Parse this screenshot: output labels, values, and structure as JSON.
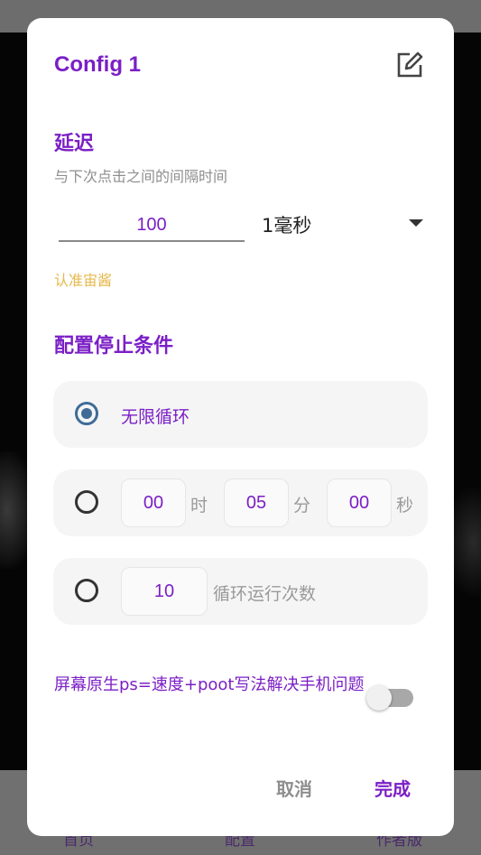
{
  "background": {
    "nav_items": [
      "首页",
      "配置",
      "作者版"
    ]
  },
  "dialog": {
    "title": "Config 1",
    "edit_icon": "edit-icon",
    "delay": {
      "title": "延迟",
      "subtitle": "与下次点击之间的间隔时间",
      "value": "100",
      "unit": "1毫秒",
      "note": "认准宙酱"
    },
    "stop": {
      "title": "配置停止条件",
      "infinite_label": "无限循环",
      "time": {
        "hours": "00",
        "hours_unit": "时",
        "minutes": "05",
        "minutes_unit": "分",
        "seconds": "00",
        "seconds_unit": "秒"
      },
      "count": {
        "value": "10",
        "label": "循环运行次数"
      },
      "selected": "infinite"
    },
    "toggle": {
      "label": "屏幕原生ps=速度+poot写法解决手机问题",
      "on": false
    },
    "buttons": {
      "cancel": "取消",
      "ok": "完成"
    }
  },
  "colors": {
    "accent": "#7b1fc6",
    "radio_selected": "#3f6c97",
    "warning": "#e6b84a"
  }
}
